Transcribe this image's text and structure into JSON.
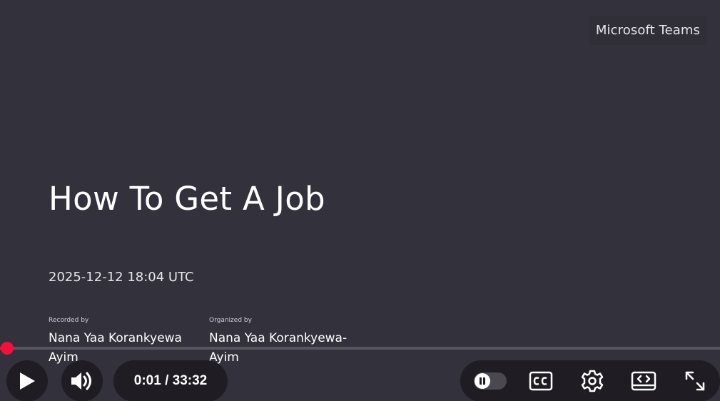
{
  "slide": {
    "brand": "Microsoft Teams",
    "title": "How To Get A Job",
    "datetime": "2025-12-12 18:04 UTC",
    "recorded_by": {
      "caption": "Recorded by",
      "name_line1": "Nana Yaa Korankyewa",
      "name_line2": "Ayim"
    },
    "organized_by": {
      "caption": "Organized by",
      "name_line1": "Nana Yaa Korankyewa-",
      "name_line2": "Ayim"
    }
  },
  "player": {
    "time_display": "0:01 / 33:32",
    "progress_fraction": 0.0005,
    "accent_color": "#f0123c",
    "controls": {
      "play": "play-icon",
      "volume": "volume-icon",
      "autoplay_toggle": "pause-toggle-icon",
      "captions": "closed-captions-icon",
      "settings": "gear-icon",
      "embed": "embed-icon",
      "fullscreen": "fullscreen-icon"
    }
  }
}
